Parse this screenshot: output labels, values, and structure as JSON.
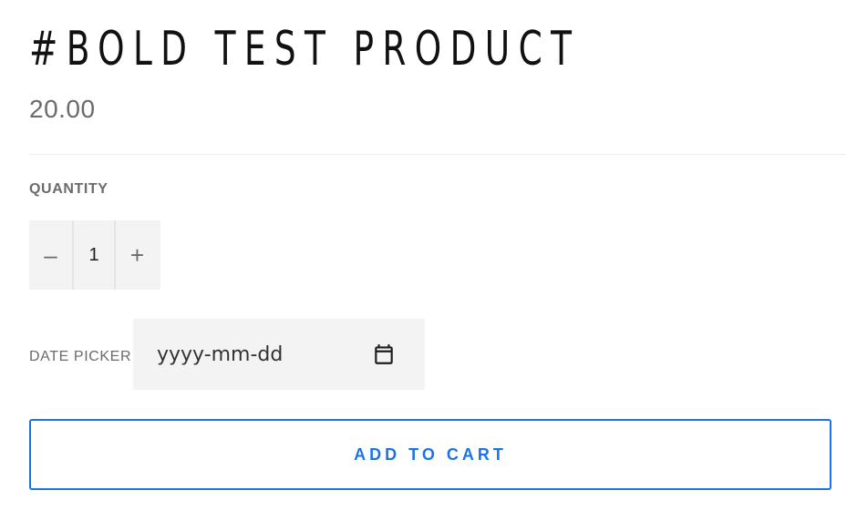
{
  "product": {
    "title": "#BOLD TEST PRODUCT",
    "price": "20.00"
  },
  "quantity": {
    "label": "QUANTITY",
    "decrement_symbol": "–",
    "value": "1",
    "increment_symbol": "+"
  },
  "date_picker": {
    "label": "DATE PICKER",
    "placeholder": "yyyy-mm-dd",
    "icon": "calendar-icon"
  },
  "cart": {
    "button_label": "ADD TO CART",
    "accent_color": "#1a73e8"
  }
}
